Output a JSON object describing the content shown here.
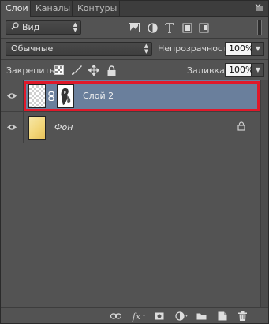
{
  "tabs": [
    {
      "label": "Слои",
      "active": true
    },
    {
      "label": "Каналы",
      "active": false
    },
    {
      "label": "Контуры",
      "active": false
    }
  ],
  "filter": {
    "kind_label": "Вид",
    "icons": [
      "image-filter-icon",
      "adjustment-filter-icon",
      "type-filter-icon",
      "shape-filter-icon",
      "smart-object-filter-icon"
    ]
  },
  "blend": {
    "mode": "Обычные",
    "opacity_label": "Непрозрачность:",
    "opacity_value": "100%"
  },
  "lock": {
    "label": "Закрепить:",
    "fill_label": "Заливка:",
    "fill_value": "100%",
    "icons": [
      "lock-transparency-icon",
      "lock-pixels-icon",
      "lock-position-icon",
      "lock-all-icon"
    ]
  },
  "layers": [
    {
      "name": "Слой 2",
      "selected": true,
      "has_mask": true,
      "visible": true
    },
    {
      "name": "Фон",
      "selected": false,
      "locked": true,
      "visible": true
    }
  ],
  "bottom_icons": [
    "link-layers-icon",
    "fx-icon",
    "add-mask-icon",
    "adjustment-layer-icon",
    "new-group-icon",
    "new-layer-icon",
    "delete-layer-icon"
  ],
  "bottom": {
    "fx_label": "fx"
  },
  "colors": {
    "panel": "#535353",
    "selected_row": "#6a7f9c",
    "highlight_outline": "#e0192a"
  }
}
